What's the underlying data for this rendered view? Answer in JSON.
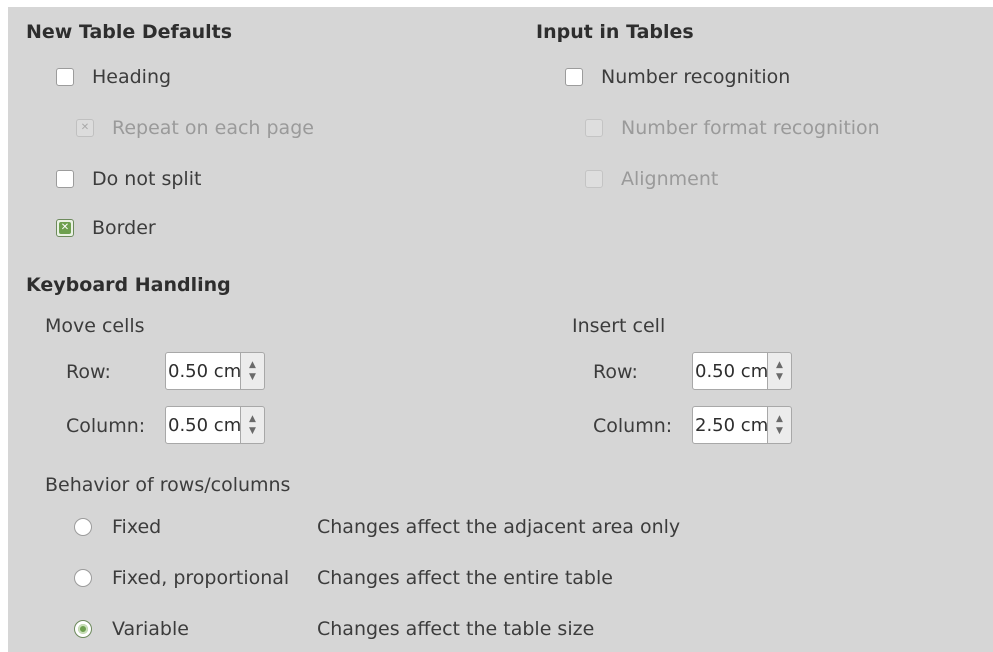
{
  "new_table_defaults": {
    "title": "New Table Defaults",
    "heading": {
      "label": "Heading",
      "checked": false
    },
    "repeat_on_each_page": {
      "label": "Repeat on each page",
      "checked": true,
      "enabled": false
    },
    "do_not_split": {
      "label": "Do not split",
      "checked": false
    },
    "border": {
      "label": "Border",
      "checked": true
    }
  },
  "input_in_tables": {
    "title": "Input in Tables",
    "number_recognition": {
      "label": "Number recognition",
      "checked": false
    },
    "number_format_recognition": {
      "label": "Number format recognition",
      "checked": false,
      "enabled": false
    },
    "alignment": {
      "label": "Alignment",
      "checked": false,
      "enabled": false
    }
  },
  "keyboard_handling": {
    "title": "Keyboard Handling",
    "move_cells": {
      "title": "Move cells",
      "row_label": "Row:",
      "row_value": "0.50 cm",
      "column_label": "Column:",
      "column_value": "0.50 cm"
    },
    "insert_cell": {
      "title": "Insert cell",
      "row_label": "Row:",
      "row_value": "0.50 cm",
      "column_label": "Column:",
      "column_value": "2.50 cm"
    },
    "behavior": {
      "title": "Behavior of rows/columns",
      "options": [
        {
          "label": "Fixed",
          "description": "Changes affect the adjacent area only",
          "selected": false
        },
        {
          "label": "Fixed, proportional",
          "description": "Changes affect the entire table",
          "selected": false
        },
        {
          "label": "Variable",
          "description": "Changes affect the table size",
          "selected": true
        }
      ]
    }
  },
  "icons": {
    "checked_mark": "✕",
    "spin_up": "▲",
    "spin_down": "▼"
  },
  "colors": {
    "panel_bg": "#d6d6d6",
    "accent_green": "#6ea04f"
  }
}
